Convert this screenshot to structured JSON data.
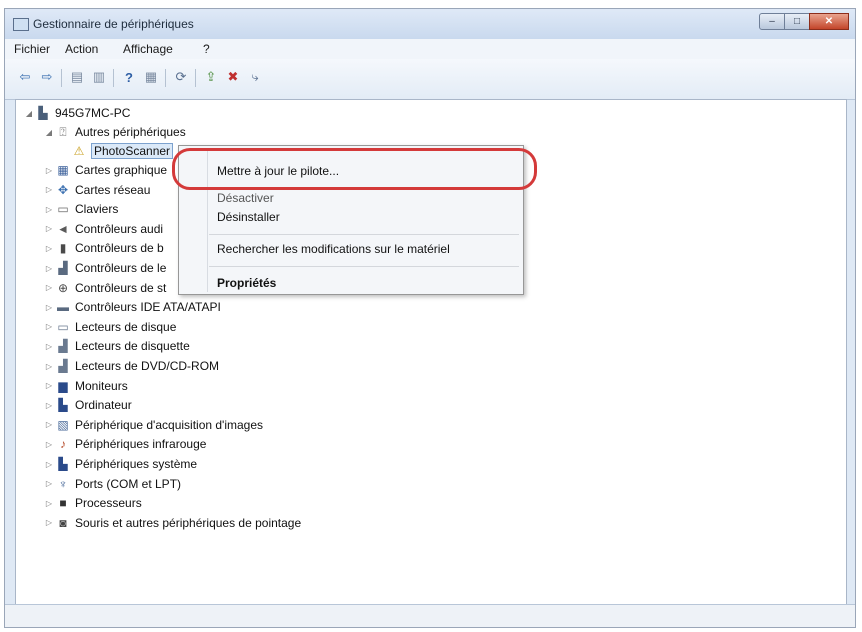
{
  "window": {
    "title": "Gestionnaire de périphériques",
    "min": "–",
    "max": "□",
    "close": "✕"
  },
  "menu": {
    "items": [
      "Fichier",
      "Action",
      "Affichage",
      "?"
    ]
  },
  "toolbar": {
    "icons": [
      "back-arrow-icon",
      "forward-arrow-icon",
      "properties-icon",
      "update-icon",
      "help-icon",
      "show-hidden-icon",
      "scan-hardware-icon",
      "update-driver-icon",
      "uninstall-icon",
      "disable-icon"
    ],
    "glyphs": [
      "⇦",
      "⇨",
      "▤",
      "▥",
      "?",
      "▦",
      "⟳",
      "⇪",
      "✖",
      "⤷"
    ]
  },
  "tree": {
    "root": "945G7MC-PC",
    "other_devices": "Autres périphériques",
    "selected_device": "PhotoScanner",
    "categories": [
      {
        "label": "Cartes graphique",
        "icon": "display-adapter-icon",
        "glyph": "▦"
      },
      {
        "label": "Cartes réseau",
        "icon": "network-adapter-icon",
        "glyph": "✥"
      },
      {
        "label": "Claviers",
        "icon": "keyboard-icon",
        "glyph": "▭"
      },
      {
        "label": "Contrôleurs audi",
        "icon": "audio-controller-icon",
        "glyph": "◄"
      },
      {
        "label": "Contrôleurs de b",
        "icon": "bus-controller-icon",
        "glyph": "▮"
      },
      {
        "label": "Contrôleurs de le",
        "icon": "storage-reader-icon",
        "glyph": "▟"
      },
      {
        "label": "Contrôleurs de st",
        "icon": "storage-controller-icon",
        "glyph": "⊕"
      },
      {
        "label": "Contrôleurs IDE ATA/ATAPI",
        "icon": "ide-controller-icon",
        "glyph": "▬"
      },
      {
        "label": "Lecteurs de disque",
        "icon": "disk-drive-icon",
        "glyph": "▭"
      },
      {
        "label": "Lecteurs de disquette",
        "icon": "floppy-drive-icon",
        "glyph": "▟"
      },
      {
        "label": "Lecteurs de DVD/CD-ROM",
        "icon": "dvd-drive-icon",
        "glyph": "▟"
      },
      {
        "label": "Moniteurs",
        "icon": "monitor-icon",
        "glyph": "▆"
      },
      {
        "label": "Ordinateur",
        "icon": "computer-icon",
        "glyph": "▙"
      },
      {
        "label": "Périphérique d'acquisition d'images",
        "icon": "imaging-device-icon",
        "glyph": "▧"
      },
      {
        "label": "Périphériques infrarouge",
        "icon": "infrared-icon",
        "glyph": "♪"
      },
      {
        "label": "Périphériques système",
        "icon": "system-device-icon",
        "glyph": "▙"
      },
      {
        "label": "Ports (COM et LPT)",
        "icon": "port-icon",
        "glyph": "♆"
      },
      {
        "label": "Processeurs",
        "icon": "processor-icon",
        "glyph": "■"
      },
      {
        "label": "Souris et autres périphériques de pointage",
        "icon": "mouse-icon",
        "glyph": "◙"
      }
    ]
  },
  "context_menu": {
    "update_driver": "Mettre à jour le pilote...",
    "disable": "Désactiver",
    "uninstall": "Désinstaller",
    "scan_changes": "Rechercher les modifications sur le matériel",
    "properties": "Propriétés"
  },
  "colors": {
    "highlight_ring": "#d43a3a",
    "selection": "#dbe9f8"
  }
}
